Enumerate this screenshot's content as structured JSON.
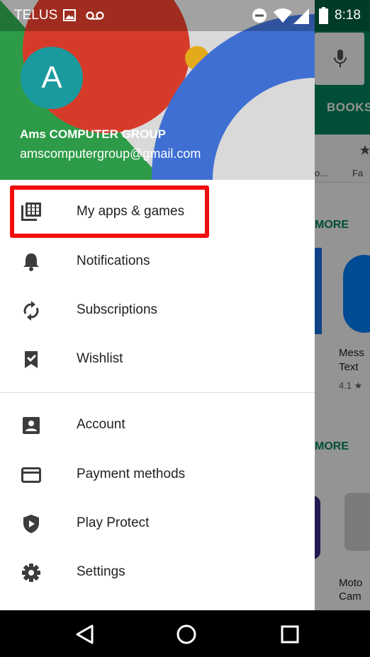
{
  "status_bar": {
    "carrier": "TELUS",
    "time": "8:18"
  },
  "drawer": {
    "avatar_letter": "A",
    "account_name": "Ams COMPUTER GROUP",
    "account_email": "amscomputergroup@gmail.com",
    "primary_items": [
      {
        "label": "My apps & games",
        "icon": "apps-grid-icon",
        "highlighted": true
      },
      {
        "label": "Notifications",
        "icon": "bell-icon"
      },
      {
        "label": "Subscriptions",
        "icon": "refresh-icon"
      },
      {
        "label": "Wishlist",
        "icon": "bookmark-check-icon"
      }
    ],
    "secondary_items": [
      {
        "label": "Account",
        "icon": "person-icon"
      },
      {
        "label": "Payment methods",
        "icon": "credit-card-icon"
      },
      {
        "label": "Play Protect",
        "icon": "shield-icon"
      },
      {
        "label": "Settings",
        "icon": "gear-icon"
      }
    ],
    "highlight_color": "#f10e0e"
  },
  "background_app": {
    "tab_books": "BOOKS",
    "category_1": "o...",
    "category_2": "Fa",
    "more_label_1": "MORE",
    "more_label_2": "MORE",
    "app1_line1": "Mess",
    "app1_line2": "Text",
    "app1_rating": "4.1 ★",
    "app2_line1": "Moto",
    "app2_line2": "Cam"
  },
  "colors": {
    "play_green": "#01875f",
    "avatar_teal": "#1a9a9f"
  }
}
